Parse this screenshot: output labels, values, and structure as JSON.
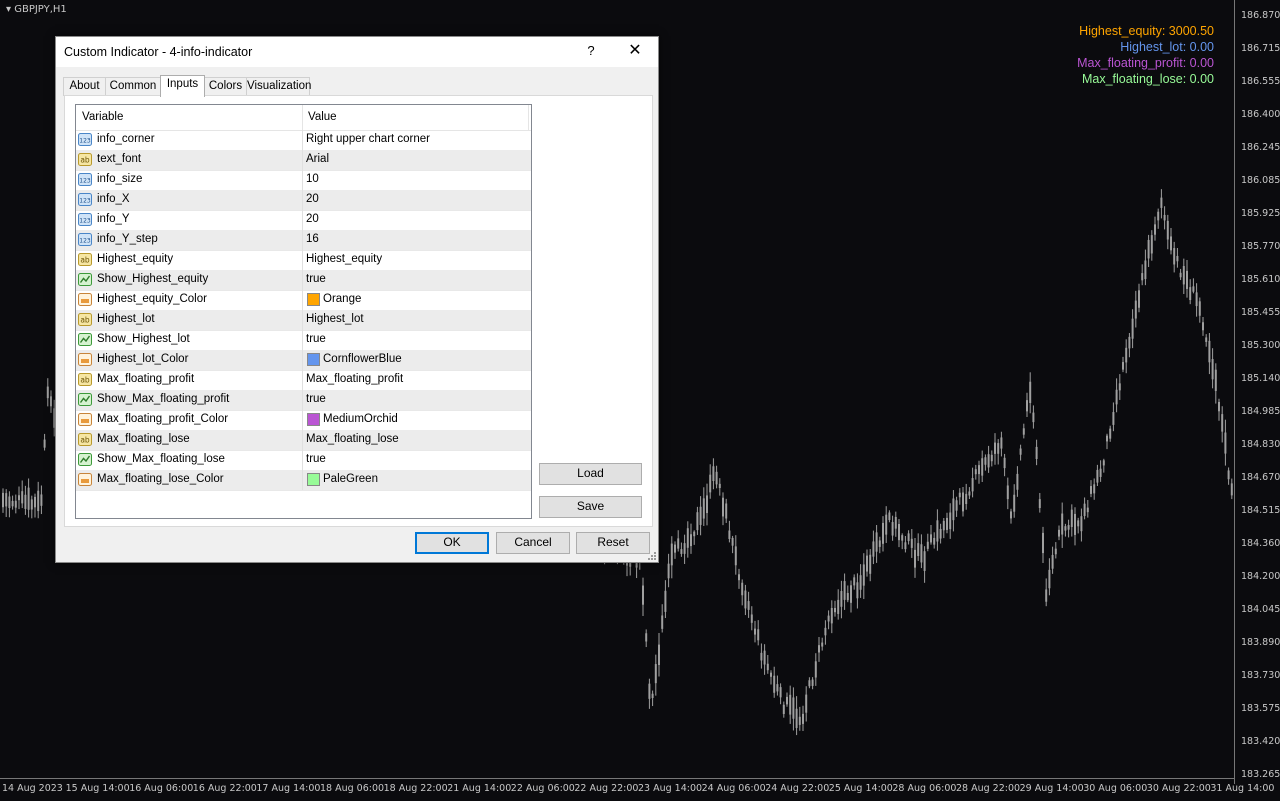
{
  "chart": {
    "symbol": "GBPJPY,H1",
    "background": "#0b0b0e",
    "candle_color": "#a0a0a0",
    "price_labels": [
      "186.870",
      "186.715",
      "186.555",
      "186.400",
      "186.245",
      "186.085",
      "185.925",
      "185.770",
      "185.610",
      "185.455",
      "185.300",
      "185.140",
      "184.985",
      "184.830",
      "184.670",
      "184.515",
      "184.360",
      "184.200",
      "184.045",
      "183.890",
      "183.730",
      "183.575",
      "183.420",
      "183.265"
    ],
    "time_labels": [
      "14 Aug 2023",
      "15 Aug 14:00",
      "16 Aug 06:00",
      "16 Aug 22:00",
      "17 Aug 14:00",
      "18 Aug 06:00",
      "18 Aug 22:00",
      "21 Aug 14:00",
      "22 Aug 06:00",
      "22 Aug 22:00",
      "23 Aug 14:00",
      "24 Aug 06:00",
      "24 Aug 22:00",
      "25 Aug 14:00",
      "28 Aug 06:00",
      "28 Aug 22:00",
      "29 Aug 14:00",
      "30 Aug 06:00",
      "30 Aug 22:00",
      "31 Aug 14:00"
    ]
  },
  "info_panel": [
    {
      "label": "Highest_equity: 3000.50",
      "color": "#FFA500"
    },
    {
      "label": "Highest_lot: 0.00",
      "color": "#6495ED"
    },
    {
      "label": "Max_floating_profit: 0.00",
      "color": "#BA55D3"
    },
    {
      "label": "Max_floating_lose: 0.00",
      "color": "#98FB98"
    }
  ],
  "dialog": {
    "title": "Custom Indicator - 4-info-indicator",
    "help": "?",
    "close": "✕",
    "tabs": [
      "About",
      "Common",
      "Inputs",
      "Colors",
      "Visualization"
    ],
    "active_tab": "Inputs",
    "columns": {
      "variable": "Variable",
      "value": "Value"
    },
    "params": [
      {
        "type": "int",
        "name": "info_corner",
        "value": "Right upper chart corner"
      },
      {
        "type": "str",
        "name": "text_font",
        "value": "Arial"
      },
      {
        "type": "int",
        "name": "info_size",
        "value": "10"
      },
      {
        "type": "int",
        "name": "info_X",
        "value": "20"
      },
      {
        "type": "int",
        "name": "info_Y",
        "value": "20"
      },
      {
        "type": "int",
        "name": "info_Y_step",
        "value": "16"
      },
      {
        "type": "str",
        "name": "Highest_equity",
        "value": "Highest_equity"
      },
      {
        "type": "bool",
        "name": "Show_Highest_equity",
        "value": "true"
      },
      {
        "type": "color",
        "name": "Highest_equity_Color",
        "value": "Orange",
        "swatch": "#FFA500"
      },
      {
        "type": "str",
        "name": "Highest_lot",
        "value": "Highest_lot"
      },
      {
        "type": "bool",
        "name": "Show_Highest_lot",
        "value": "true"
      },
      {
        "type": "color",
        "name": "Highest_lot_Color",
        "value": "CornflowerBlue",
        "swatch": "#6495ED"
      },
      {
        "type": "str",
        "name": "Max_floating_profit",
        "value": "Max_floating_profit"
      },
      {
        "type": "bool",
        "name": "Show_Max_floating_profit",
        "value": "true"
      },
      {
        "type": "color",
        "name": "Max_floating_profit_Color",
        "value": "MediumOrchid",
        "swatch": "#BA55D3"
      },
      {
        "type": "str",
        "name": "Max_floating_lose",
        "value": "Max_floating_lose"
      },
      {
        "type": "bool",
        "name": "Show_Max_floating_lose",
        "value": "true"
      },
      {
        "type": "color",
        "name": "Max_floating_lose_Color",
        "value": "PaleGreen",
        "swatch": "#98FB98"
      }
    ],
    "load_label": "Load",
    "save_label": "Save",
    "ok_label": "OK",
    "cancel_label": "Cancel",
    "reset_label": "Reset"
  }
}
